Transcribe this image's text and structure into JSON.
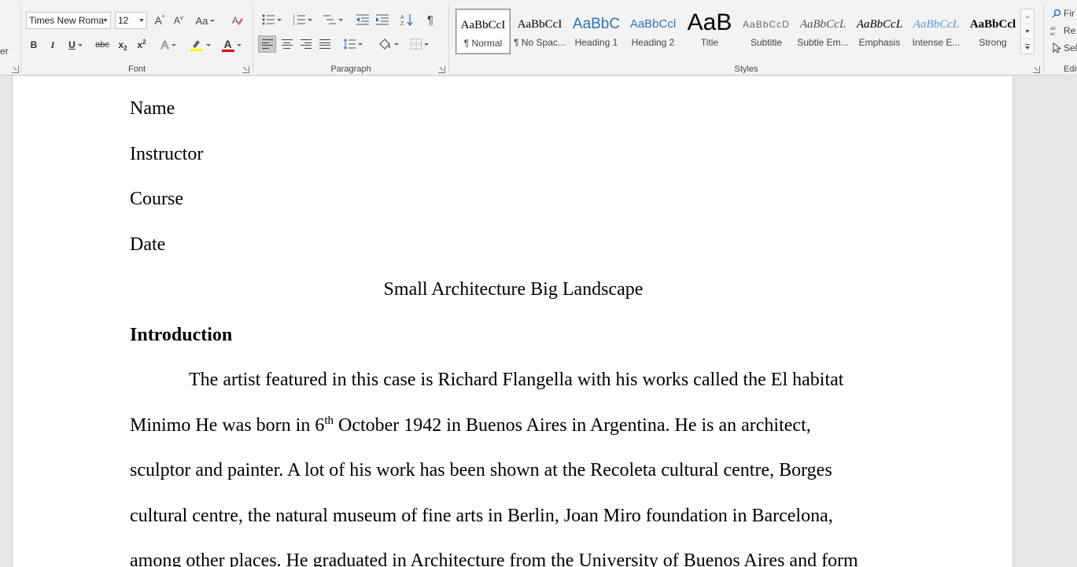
{
  "ribbon": {
    "clipboard_fragment": "er",
    "font": {
      "label": "Font",
      "font_name": "Times New Roma",
      "font_size": "12",
      "grow_label": "A",
      "shrink_label": "A",
      "change_case_label": "Aa",
      "bold": "B",
      "italic": "I",
      "underline": "U",
      "strikethrough": "abc",
      "subscript": "x",
      "superscript": "x",
      "text_effects": "A",
      "font_color": "A",
      "highlight_color": "#ffff00",
      "font_color_value": "#e00000"
    },
    "paragraph": {
      "label": "Paragraph",
      "show_marks": "¶",
      "sort_label": "A"
    },
    "styles": {
      "label": "Styles",
      "items": [
        {
          "preview": "AaBbCcI",
          "name": "¶ Normal"
        },
        {
          "preview": "AaBbCcI",
          "name": "¶ No Spac..."
        },
        {
          "preview": "AaBbC",
          "name": "Heading 1"
        },
        {
          "preview": "AaBbCcl",
          "name": "Heading 2"
        },
        {
          "preview": "AaB",
          "name": "Title"
        },
        {
          "preview": "AaBbCcD",
          "name": "Subtitle"
        },
        {
          "preview": "AaBbCcL",
          "name": "Subtle Em..."
        },
        {
          "preview": "AaBbCcL",
          "name": "Emphasis"
        },
        {
          "preview": "AaBbCcL",
          "name": "Intense E..."
        },
        {
          "preview": "AaBbCcl",
          "name": "Strong"
        }
      ]
    },
    "editing": {
      "label": "Edit",
      "find": "Fir",
      "replace": "Re",
      "select": "Sel"
    }
  },
  "document": {
    "name": "Name",
    "instructor": "Instructor",
    "course": "Course",
    "date": "Date",
    "title": "Small Architecture Big Landscape",
    "heading": "Introduction",
    "para1_line1": "The artist featured in this case is Richard Flangella with his works called the El habitat",
    "para1_line2_a": "Minimo He was born in 6",
    "para1_line2_sup": "th",
    "para1_line2_b": " October 1942 in Buenos Aires in Argentina. He is an architect,",
    "para1_line3": "sculptor and painter. A lot of his work has been shown at the Recoleta cultural centre, Borges",
    "para1_line4": "cultural centre, the natural museum of fine arts in Berlin, Joan Miro foundation in Barcelona,",
    "para1_line5": "among other places. He graduated in Architecture from the University of Buenos Aires and form"
  }
}
